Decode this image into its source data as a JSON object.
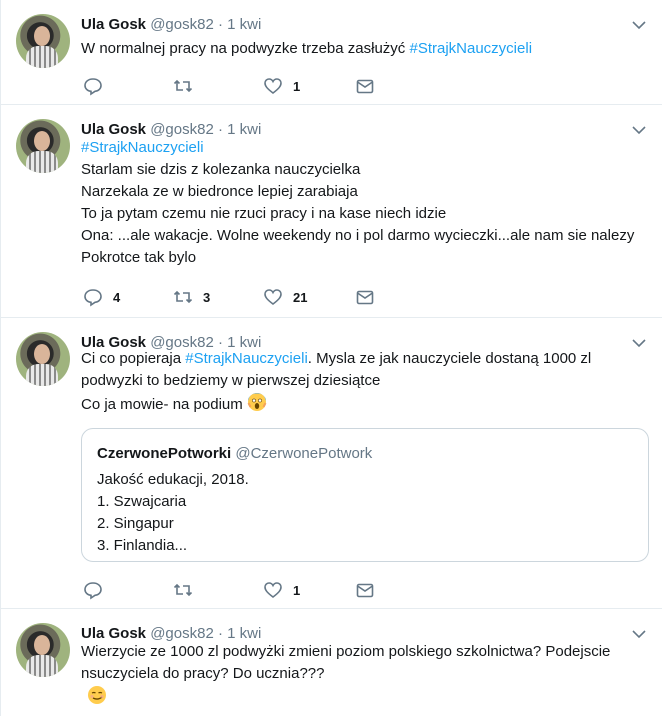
{
  "tweets": [
    {
      "name": "Ula Gosk",
      "handle": "@gosk82",
      "sep": "·",
      "time": "1 kwi",
      "line1_text": "W normalnej pracy na podwyzke trzeba zasłużyć ",
      "line1_hashtag": "#StrajkNauczycieli",
      "replies": "",
      "retweets": "",
      "likes": "1"
    },
    {
      "name": "Ula Gosk",
      "handle": "@gosk82",
      "sep": "·",
      "time": "1 kwi",
      "hashtag": "#StrajkNauczycieli",
      "lines": [
        "Starlam sie dzis z kolezanka nauczycielka",
        "Narzekala ze w biedronce lepiej zarabiaja",
        "To ja pytam czemu nie rzuci pracy i na kase niech idzie",
        "Ona: ...ale wakacje. Wolne weekendy no i pol darmo wycieczki...ale nam sie nalezy",
        "Pokrotce tak bylo"
      ],
      "replies": "4",
      "retweets": "3",
      "likes": "21"
    },
    {
      "name": "Ula Gosk",
      "handle": "@gosk82",
      "sep": "·",
      "time": "1 kwi",
      "line1_pre": "Ci co popieraja ",
      "line1_hashtag": "#StrajkNauczycieli",
      "line1_post": ". Mysla ze jak nauczyciele dostaną 1000 zl",
      "line2": "podwyzki to bedziemy w pierwszej dziesiątce",
      "line3": "Co ja mowie- na podium ",
      "emoji": "screaming-face-emoji",
      "quote": {
        "name": "CzerwonePotworki",
        "handle": "@CzerwonePotwork",
        "lines": [
          "Jakość edukacji, 2018.",
          "1. Szwajcaria",
          "2. Singapur",
          "3. Finlandia..."
        ]
      },
      "replies": "",
      "retweets": "",
      "likes": "1"
    },
    {
      "name": "Ula Gosk",
      "handle": "@gosk82",
      "sep": "·",
      "time": "1 kwi",
      "lines": [
        "Wierzycie ze 1000 zl podwyżki zmieni poziom polskiego szkolnictwa? Podejscie",
        "nsuczyciela do pracy? Do ucznia???"
      ],
      "emoji": "smirking-face-emoji"
    }
  ],
  "icons": {
    "reply": "reply-icon",
    "retweet": "retweet-icon",
    "like": "heart-icon",
    "dm": "envelope-icon",
    "more": "chevron-down-icon"
  },
  "colors": {
    "hashtag": "#1da1f2",
    "secondary": "#657786",
    "border": "#e6ecf0"
  }
}
